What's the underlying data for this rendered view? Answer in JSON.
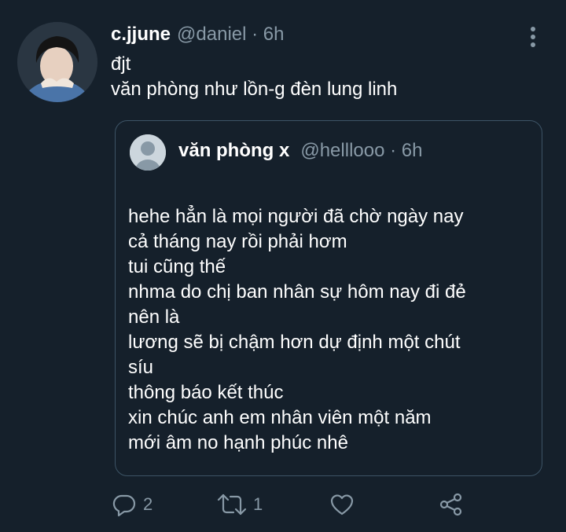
{
  "tweet": {
    "display_name": "c.jjune",
    "handle_time": "@daniel · 6h",
    "text": "đjt\nvăn phòng như lồn-g đèn lung linh"
  },
  "quote": {
    "display_name": "văn phòng x",
    "handle_time": "@helllooo · 6h",
    "lines": [
      "hehe hẳn là mọi người đã chờ ngày nay",
      "cả tháng nay rồi phải hơm",
      "tui cũng thế",
      "nhma do chị ban nhân sự hôm nay đi đẻ",
      "nên là",
      "lương sẽ bị chậm hơn dự định một chút",
      "síu",
      "thông báo kết thúc",
      "xin chúc anh em nhân viên một năm",
      "mới âm no hạnh phúc nhê"
    ]
  },
  "actions": {
    "reply_count": "2",
    "retweet_count": "1"
  },
  "icons": {
    "more": "more-vertical-icon",
    "reply": "reply-icon",
    "retweet": "retweet-icon",
    "like": "heart-icon",
    "share": "share-icon"
  },
  "colors": {
    "background": "#15202b",
    "text": "#ffffff",
    "secondary": "#8899a6",
    "quote_border": "#3d5466"
  }
}
